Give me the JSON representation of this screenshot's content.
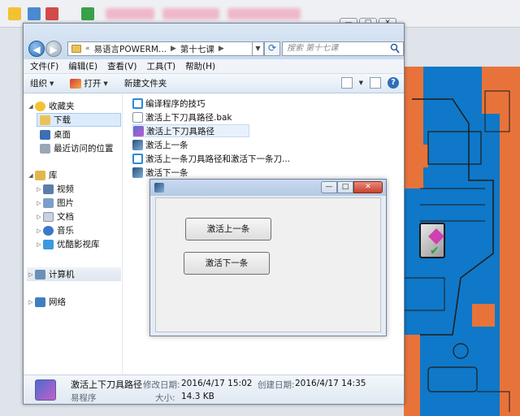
{
  "address": {
    "overflow": "«",
    "segment1": "易语言POWERM...",
    "segment2": "第十七课"
  },
  "search": {
    "placeholder": "搜索 第十七课"
  },
  "menu": {
    "file": "文件(F)",
    "edit": "编辑(E)",
    "view": "查看(V)",
    "tools": "工具(T)",
    "help": "帮助(H)"
  },
  "toolbar": {
    "organize": "组织",
    "open": "打开",
    "new_folder": "新建文件夹"
  },
  "nav": {
    "favorites": "收藏夹",
    "downloads": "下载",
    "desktop": "桌面",
    "recent": "最近访问的位置",
    "libraries": "库",
    "videos": "视频",
    "pictures": "图片",
    "documents": "文档",
    "music": "音乐",
    "youku": "优酷影视库",
    "computer": "计算机",
    "network": "网络"
  },
  "files": [
    {
      "name": "编译程序的技巧"
    },
    {
      "name": "激活上下刀具路径.bak"
    },
    {
      "name": "激活上下刀具路径"
    },
    {
      "name": "激活上一条"
    },
    {
      "name": "激活上一条刀具路径和激活下一条刀..."
    },
    {
      "name": "激活下一条"
    }
  ],
  "details": {
    "name": "激活上下刀具路径",
    "type": "易程序",
    "modified_label": "修改日期:",
    "modified_value": "2016/4/17 15:02",
    "created_label": "创建日期:",
    "created_value": "2016/4/17 14:35",
    "size_label": "大小:",
    "size_value": "14.3 KB"
  },
  "dialog": {
    "btn_prev": "激活上一条",
    "btn_next": "激活下一条",
    "min": "—",
    "max": "□",
    "close": "✕"
  },
  "cad": {
    "ctl_min": "—",
    "ctl_max": "□",
    "ctl_close": "✕"
  },
  "colors": {
    "viewport_blue": "#0f78c8",
    "viewport_orange": "#e8733a",
    "selection": "#dcebfb"
  }
}
